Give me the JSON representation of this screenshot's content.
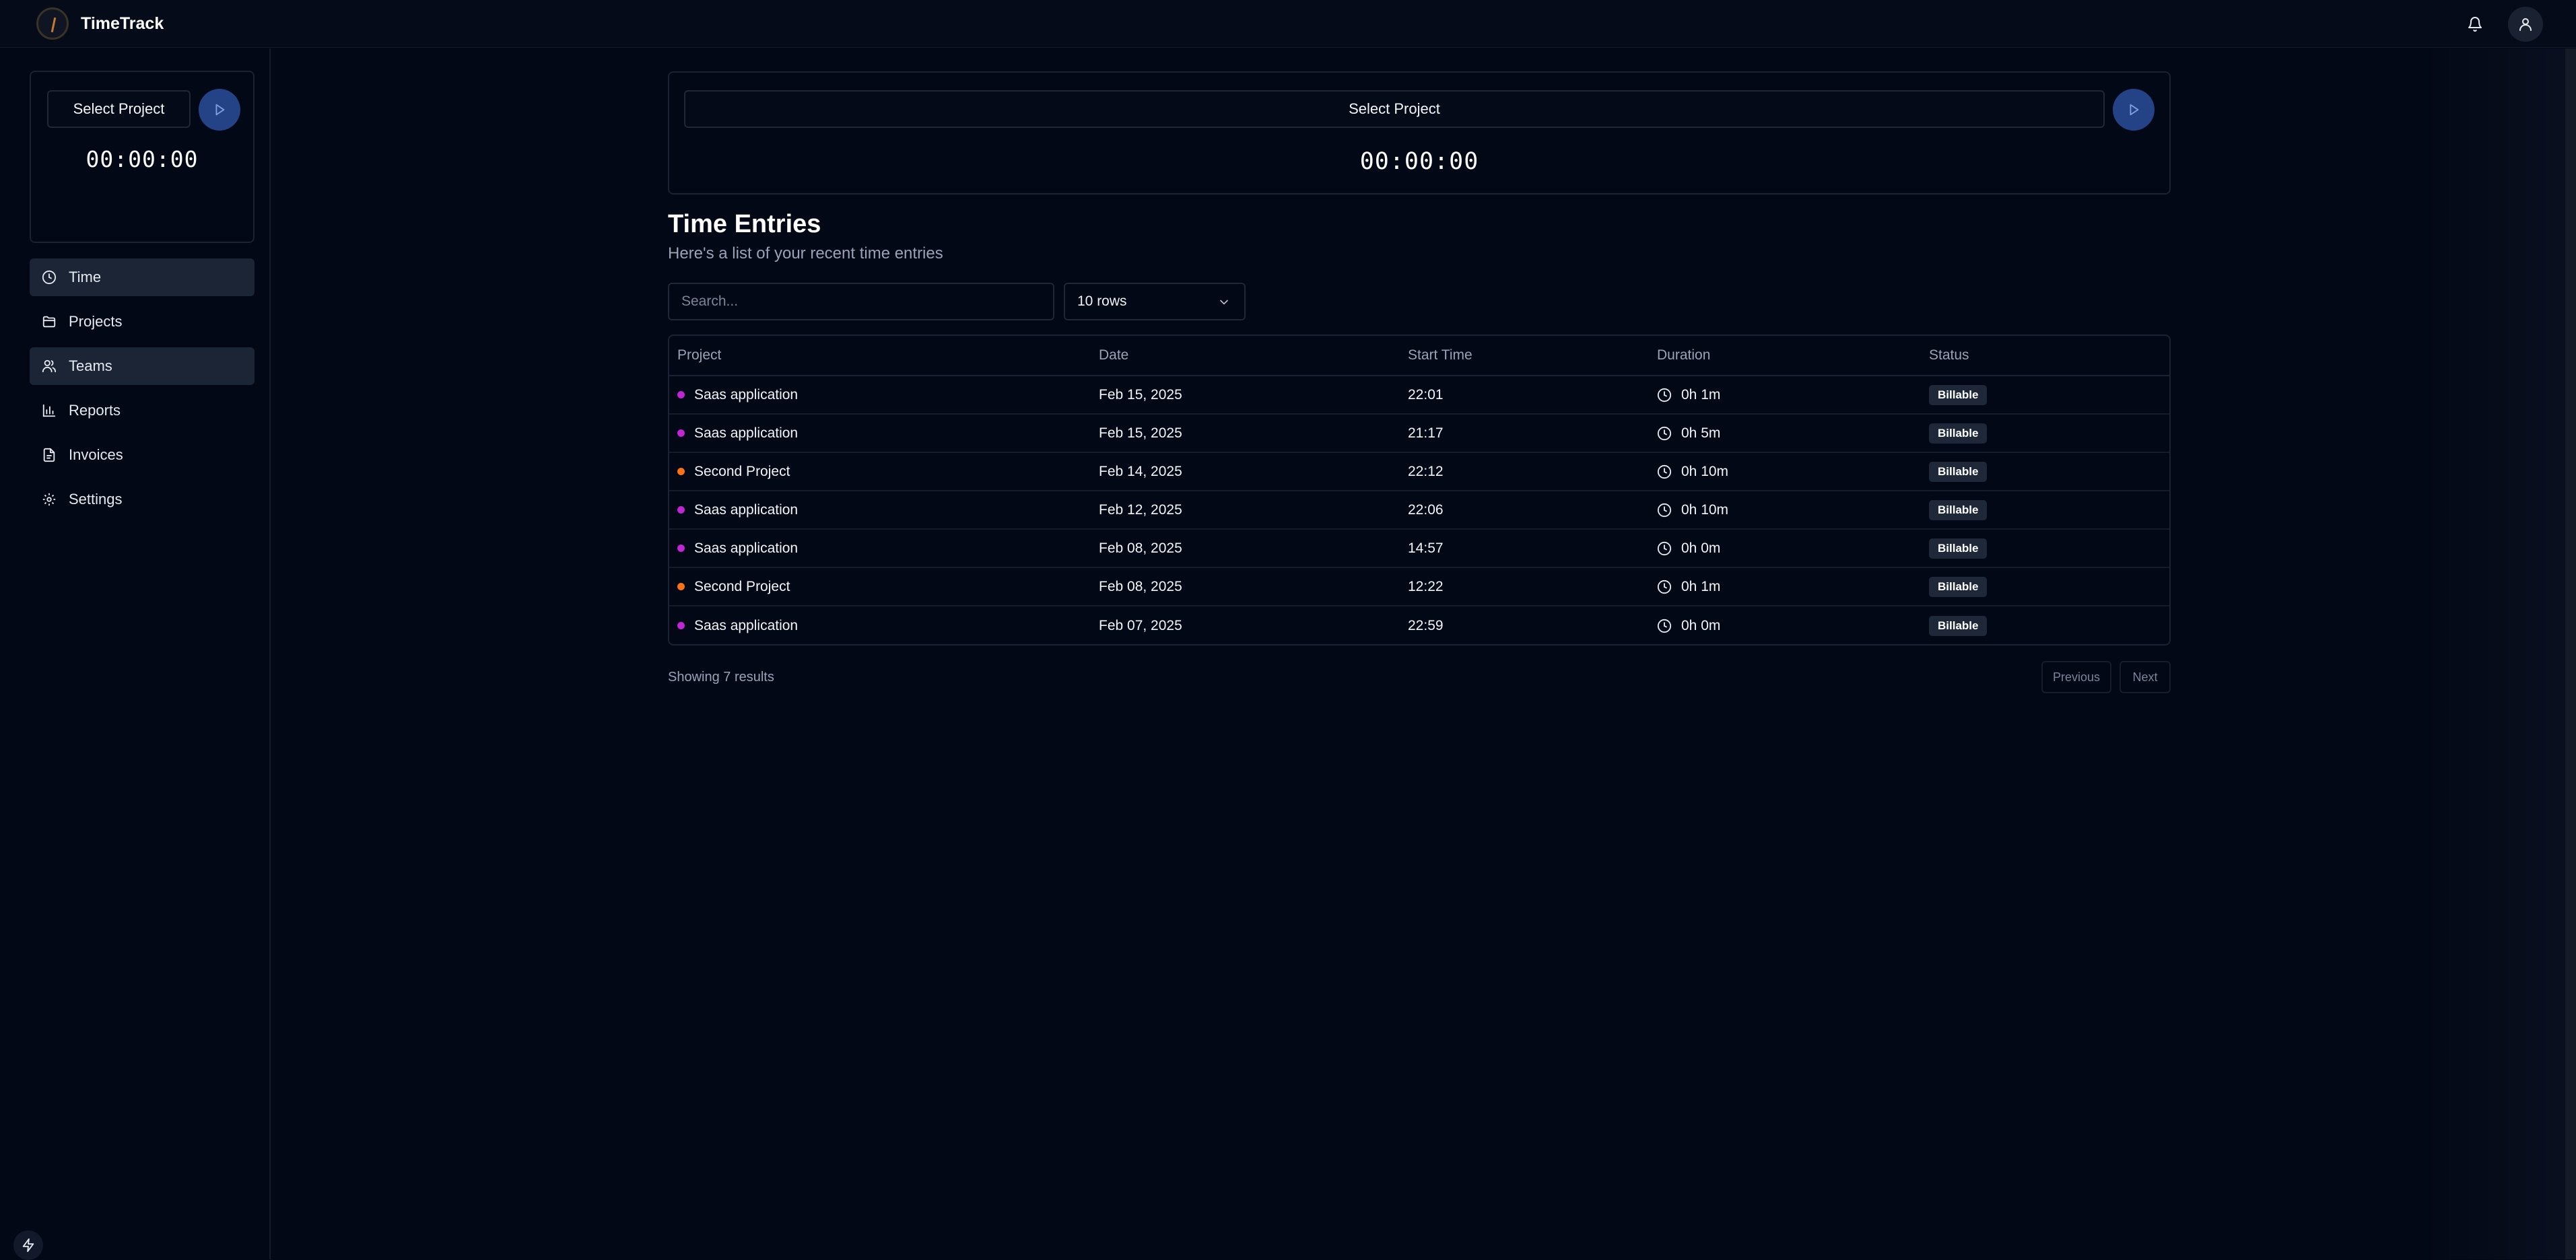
{
  "app": {
    "name": "TimeTrack"
  },
  "header": {
    "notifications_icon": "bell-icon",
    "account_icon": "user-icon"
  },
  "sidebar": {
    "timer": {
      "select_label": "Select Project",
      "time": "00:00:00"
    },
    "items": [
      {
        "label": "Time",
        "icon": "clock-icon",
        "active": true
      },
      {
        "label": "Projects",
        "icon": "folder-icon",
        "active": false
      },
      {
        "label": "Teams",
        "icon": "users-icon",
        "active": true
      },
      {
        "label": "Reports",
        "icon": "bar-chart-icon",
        "active": false
      },
      {
        "label": "Invoices",
        "icon": "file-icon",
        "active": false
      },
      {
        "label": "Settings",
        "icon": "gear-icon",
        "active": false
      }
    ]
  },
  "main": {
    "timer": {
      "select_label": "Select Project",
      "time": "00:00:00"
    },
    "title": "Time Entries",
    "subtitle": "Here's a list of your recent time entries",
    "search": {
      "placeholder": "Search...",
      "value": ""
    },
    "rows_select": {
      "value": "10 rows"
    },
    "table": {
      "columns": [
        "Project",
        "Date",
        "Start Time",
        "Duration",
        "Status"
      ],
      "rows": [
        {
          "project": "Saas application",
          "color": "#c026d3",
          "date": "Feb 15, 2025",
          "start": "22:01",
          "duration": "0h 1m",
          "status": "Billable"
        },
        {
          "project": "Saas application",
          "color": "#c026d3",
          "date": "Feb 15, 2025",
          "start": "21:17",
          "duration": "0h 5m",
          "status": "Billable"
        },
        {
          "project": "Second Project",
          "color": "#f97316",
          "date": "Feb 14, 2025",
          "start": "22:12",
          "duration": "0h 10m",
          "status": "Billable"
        },
        {
          "project": "Saas application",
          "color": "#c026d3",
          "date": "Feb 12, 2025",
          "start": "22:06",
          "duration": "0h 10m",
          "status": "Billable"
        },
        {
          "project": "Saas application",
          "color": "#c026d3",
          "date": "Feb 08, 2025",
          "start": "14:57",
          "duration": "0h 0m",
          "status": "Billable"
        },
        {
          "project": "Second Project",
          "color": "#f97316",
          "date": "Feb 08, 2025",
          "start": "12:22",
          "duration": "0h 1m",
          "status": "Billable"
        },
        {
          "project": "Saas application",
          "color": "#c026d3",
          "date": "Feb 07, 2025",
          "start": "22:59",
          "duration": "0h 0m",
          "status": "Billable"
        }
      ]
    },
    "footer": {
      "showing": "Showing 7 results",
      "previous": "Previous",
      "next": "Next"
    }
  },
  "colors": {
    "background": "#030816",
    "accent": "#244386",
    "saas": "#c026d3",
    "second": "#f97316"
  }
}
